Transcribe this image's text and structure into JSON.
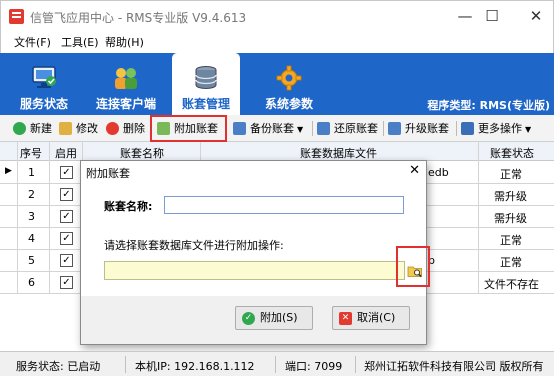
{
  "window": {
    "title": "信管飞应用中心 - RMS专业版 V9.4.613",
    "minimize": "—",
    "maximize": "☐",
    "close": "✕"
  },
  "menu": [
    "文件(F)",
    "工具(E)",
    "帮助(H)"
  ],
  "nav_tabs": [
    {
      "label": "服务状态",
      "icon": "monitor-icon"
    },
    {
      "label": "连接客户端",
      "icon": "users-icon"
    },
    {
      "label": "账套管理",
      "icon": "database-icon",
      "active": true
    },
    {
      "label": "系统参数",
      "icon": "gear-icon"
    }
  ],
  "program_type": "程序类型: RMS(专业版)",
  "toolbar": {
    "new": "新建",
    "edit": "修改",
    "delete": "删除",
    "attach": "附加账套",
    "backup": "备份账套",
    "restore": "还原账套",
    "upgrade": "升级账套",
    "more": "更多操作"
  },
  "grid": {
    "headers": [
      "序号",
      "启用",
      "账套名称",
      "账套数据库文件",
      "账套状态"
    ],
    "rows": [
      {
        "no": "1",
        "file_suffix": "edb",
        "status": "正常"
      },
      {
        "no": "2",
        "file_suffix": "",
        "status": "需升级"
      },
      {
        "no": "3",
        "file_suffix": "",
        "status": "需升级"
      },
      {
        "no": "4",
        "file_suffix": "",
        "status": "正常"
      },
      {
        "no": "5",
        "file_suffix": "b",
        "status": "正常"
      },
      {
        "no": "6",
        "file_suffix": "",
        "status": "文件不存在"
      }
    ]
  },
  "dialog": {
    "title": "附加账套",
    "close": "✕",
    "name_label": "账套名称:",
    "name_value": "",
    "path_label": "请选择账套数据库文件进行附加操作:",
    "path_value": "",
    "ok": "附加(S)",
    "cancel": "取消(C)"
  },
  "status": {
    "service": "服务状态: 已启动",
    "ip": "本机IP: 192.168.1.112",
    "port": "端口: 7099",
    "company": "郑州讧拓软件科技有限公司 版权所有"
  },
  "colors": {
    "accent": "#1f66c9",
    "highlight": "#e23030",
    "path_bg": "#fdfbd2"
  }
}
